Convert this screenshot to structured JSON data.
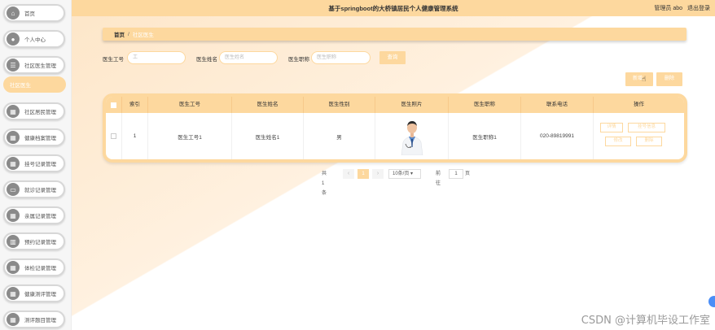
{
  "header": {
    "title": "基于springboot的大桥镇居民个人健康管理系统",
    "user_label": "管理员 abo",
    "logout": "退出登录"
  },
  "sidebar": {
    "items": [
      {
        "label": "首页",
        "icon": "home-icon",
        "glyph": "⌂",
        "active": false
      },
      {
        "label": "个人中心",
        "icon": "user-icon",
        "glyph": "●",
        "active": false
      },
      {
        "label": "社区医生管理",
        "icon": "list-icon",
        "glyph": "☰",
        "active": false
      },
      {
        "label": "社区医生",
        "icon": "",
        "glyph": "",
        "active": true
      },
      {
        "label": "社区居民管理",
        "icon": "grid-icon",
        "glyph": "▦",
        "active": false
      },
      {
        "label": "健康档案管理",
        "icon": "grid-icon",
        "glyph": "▦",
        "active": false
      },
      {
        "label": "挂号记录管理",
        "icon": "grid-icon",
        "glyph": "▦",
        "active": false
      },
      {
        "label": "就诊记录管理",
        "icon": "chat-icon",
        "glyph": "▭",
        "active": false
      },
      {
        "label": "亲属记录管理",
        "icon": "grid-icon",
        "glyph": "▦",
        "active": false
      },
      {
        "label": "预约记录管理",
        "icon": "chart-icon",
        "glyph": "▥",
        "active": false
      },
      {
        "label": "体检记录管理",
        "icon": "grid-icon",
        "glyph": "▦",
        "active": false
      },
      {
        "label": "健康测评管理",
        "icon": "grid-icon",
        "glyph": "▦",
        "active": false
      },
      {
        "label": "测评题目管理",
        "icon": "grid-icon",
        "glyph": "▦",
        "active": false
      }
    ]
  },
  "breadcrumb": {
    "home": "首页",
    "sep": "/",
    "current": "社区医生"
  },
  "search": {
    "f1_label": "医生工号",
    "f1_placeholder": "工",
    "f2_label": "医生姓名",
    "f2_placeholder": "医生姓名",
    "f3_label": "医生职称",
    "f3_placeholder": "医生职称",
    "query": "查询"
  },
  "actions": {
    "add": "新增",
    "delete": "删除"
  },
  "table": {
    "headers": [
      "",
      "索引",
      "医生工号",
      "医生姓名",
      "医生性别",
      "医生照片",
      "医生职称",
      "联系电话",
      "操作"
    ],
    "rows": [
      {
        "index": "1",
        "doctor_no": "医生工号1",
        "name": "医生姓名1",
        "gender": "男",
        "title": "医生职称1",
        "phone": "020-89819991",
        "ops": [
          "详情",
          "挂号信息",
          "修改",
          "删除"
        ]
      }
    ]
  },
  "pager": {
    "total": "共 1 条",
    "prev": "‹",
    "current": "1",
    "next": "›",
    "size": "10条/页",
    "goto": "前往",
    "goto_value": "1",
    "page_unit": "页"
  },
  "watermark": "CSDN @计算机毕设工作室"
}
